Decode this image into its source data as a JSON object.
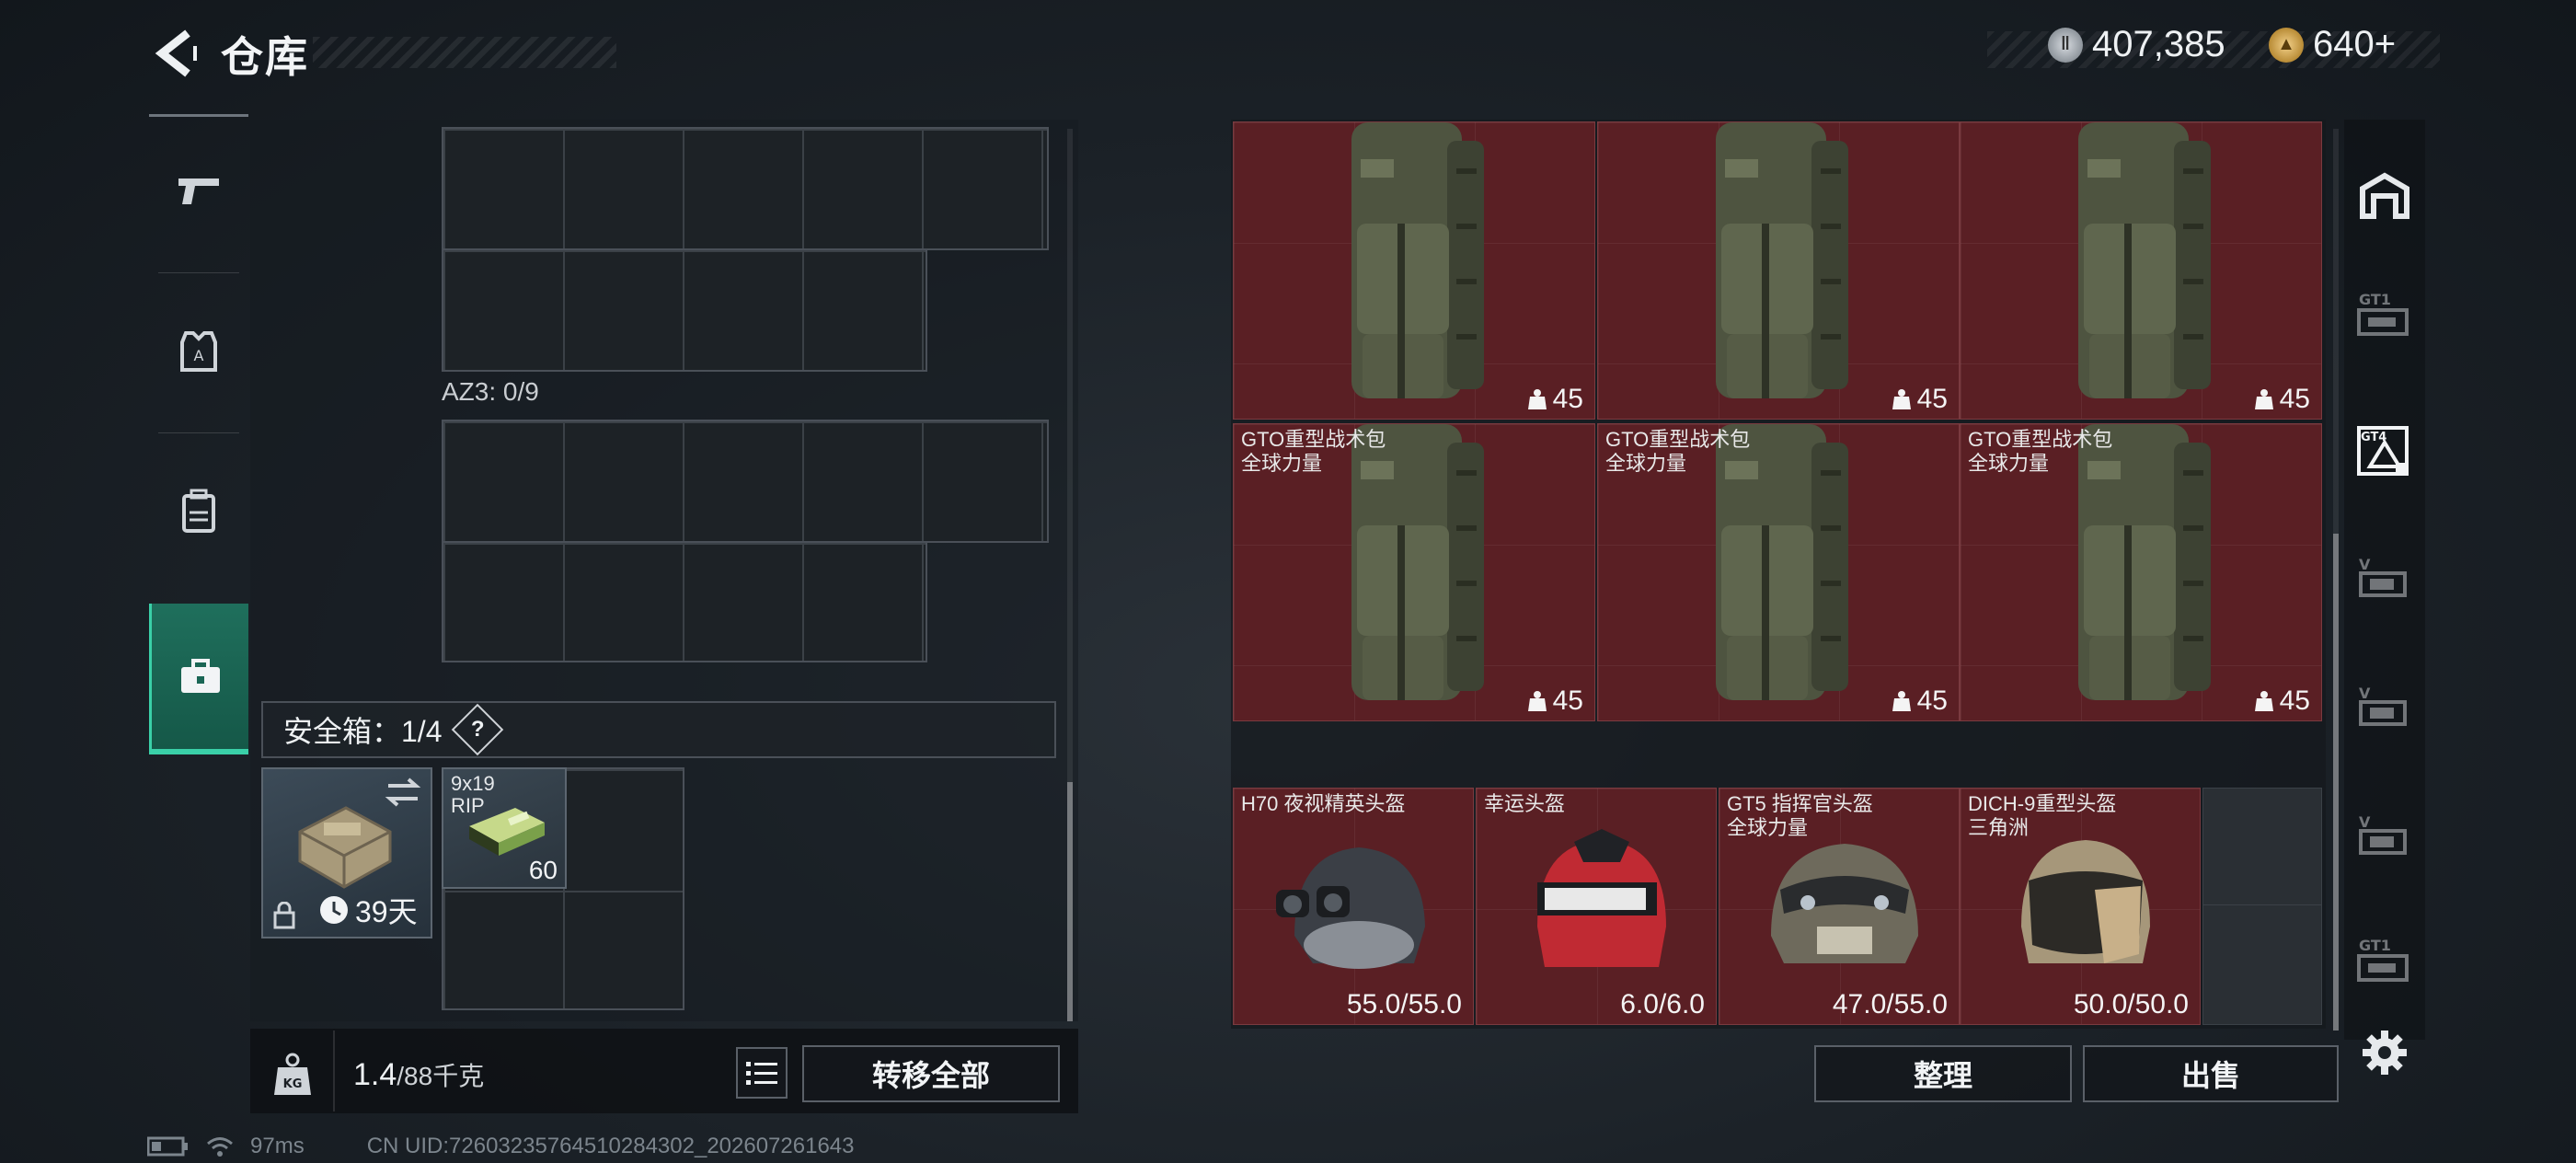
{
  "header": {
    "title": "仓库",
    "currency_primary": "407,385",
    "currency_secondary": "640+"
  },
  "rail": {
    "items": [
      {
        "icon": "pistol-icon"
      },
      {
        "icon": "armor-vest-icon"
      },
      {
        "icon": "backpack-icon"
      },
      {
        "icon": "toolbox-icon",
        "active": true
      }
    ]
  },
  "left": {
    "container_label": "AZ3: 0/9",
    "safebox_label": "安全箱：1/4",
    "safebox_help": "?",
    "case_days": "39天",
    "ammo_name": "9x19",
    "ammo_sub": "RIP",
    "ammo_count": "60",
    "weight_value": "1.4",
    "weight_unit": "/88千克",
    "transfer_all": "转移全部"
  },
  "right": {
    "bags": [
      {
        "name": "",
        "sub": "",
        "value": "45"
      },
      {
        "name": "",
        "sub": "",
        "value": "45"
      },
      {
        "name": "",
        "sub": "",
        "value": "45"
      },
      {
        "name": "GTO重型战术包",
        "sub": "全球力量",
        "value": "45"
      },
      {
        "name": "GTO重型战术包",
        "sub": "全球力量",
        "value": "45"
      },
      {
        "name": "GTO重型战术包",
        "sub": "全球力量",
        "value": "45"
      }
    ],
    "helmets": [
      {
        "name": "H70 夜视精英头盔",
        "sub": "",
        "durability": "55.0/55.0"
      },
      {
        "name": "幸运头盔",
        "sub": "",
        "durability": "6.0/6.0"
      },
      {
        "name": "GT5 指挥官头盔",
        "sub": "全球力量",
        "durability": "47.0/55.0"
      },
      {
        "name": "DICH-9重型头盔",
        "sub": "三角洲",
        "durability": "50.0/50.0"
      }
    ],
    "sort_button": "整理",
    "sell_button": "出售"
  },
  "footer": {
    "ping": "97ms",
    "uid": "CN UID:7260323576451028430​2_202607261643"
  },
  "colors": {
    "accent": "#3ad0a8",
    "cell_red": "#5a1f24"
  }
}
